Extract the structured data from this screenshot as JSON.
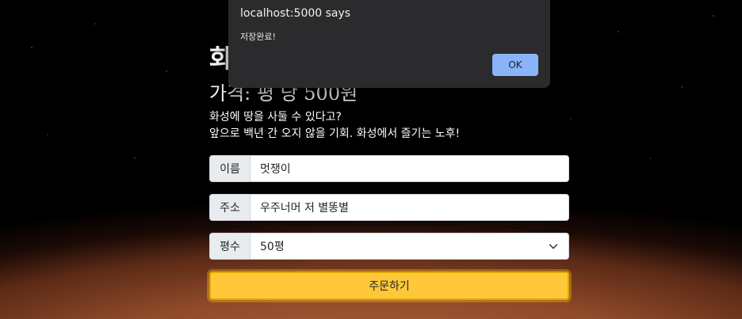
{
  "page": {
    "title": "화",
    "price": "가격: 평 당 500원",
    "desc_line1": "화성에 땅을 사둘 수 있다고?",
    "desc_line2": "앞으로 백년 간 오지 않을 기회. 화성에서 즐기는 노후!"
  },
  "form": {
    "name_label": "이름",
    "name_value": "멋쟁이",
    "address_label": "주소",
    "address_value": "우주너머 저 별똥별",
    "size_label": "평수",
    "size_value": "50평",
    "order_button": "주문하기"
  },
  "dialog": {
    "title": "localhost:5000 says",
    "message": "저장완료!",
    "ok_label": "OK"
  },
  "colors": {
    "accent": "#ffc83a",
    "dialog_bg": "#2b2b2d",
    "dialog_button": "#8ab4f8"
  },
  "icons": {
    "select_arrow": "chevron-down-icon"
  }
}
